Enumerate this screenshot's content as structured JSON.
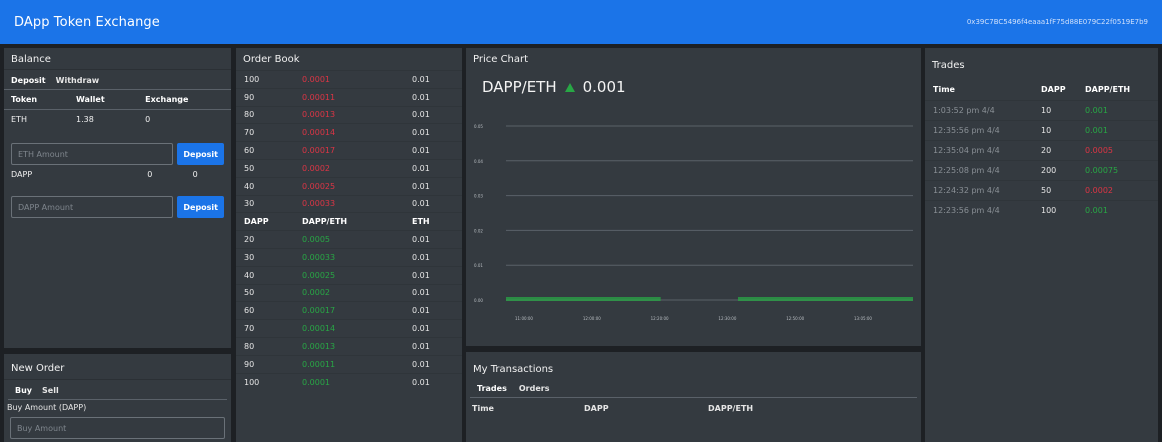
{
  "navbar": {
    "brand": "DApp Token Exchange",
    "account": "0x39C7BC5496f4eaaa1fF75d88E079C22f0519E7b9"
  },
  "balance": {
    "title": "Balance",
    "tabs": [
      "Deposit",
      "Withdraw"
    ],
    "columns": [
      "Token",
      "Wallet",
      "Exchange"
    ],
    "eth_row": [
      "ETH",
      "1.38",
      "0"
    ],
    "eth_placeholder": "ETH Amount",
    "deposit_label": "Deposit",
    "dapp_row": [
      "DAPP",
      "0",
      "0"
    ],
    "dapp_placeholder": "DAPP Amount"
  },
  "order_book": {
    "title": "Order Book",
    "sell_orders": [
      [
        "100",
        "0.0001",
        "0.01"
      ],
      [
        "90",
        "0.00011",
        "0.01"
      ],
      [
        "80",
        "0.00013",
        "0.01"
      ],
      [
        "70",
        "0.00014",
        "0.01"
      ],
      [
        "60",
        "0.00017",
        "0.01"
      ],
      [
        "50",
        "0.0002",
        "0.01"
      ],
      [
        "40",
        "0.00025",
        "0.01"
      ],
      [
        "30",
        "0.00033",
        "0.01"
      ]
    ],
    "header": [
      "DAPP",
      "DAPP/ETH",
      "ETH"
    ],
    "buy_orders": [
      [
        "20",
        "0.0005",
        "0.01"
      ],
      [
        "30",
        "0.00033",
        "0.01"
      ],
      [
        "40",
        "0.00025",
        "0.01"
      ],
      [
        "50",
        "0.0002",
        "0.01"
      ],
      [
        "60",
        "0.00017",
        "0.01"
      ],
      [
        "70",
        "0.00014",
        "0.01"
      ],
      [
        "80",
        "0.00013",
        "0.01"
      ],
      [
        "90",
        "0.00011",
        "0.01"
      ],
      [
        "100",
        "0.0001",
        "0.01"
      ]
    ]
  },
  "price_chart": {
    "title": "Price Chart",
    "pair": "DAPP/ETH",
    "price": "0.001",
    "colors": {
      "up": "#28a745",
      "grid": "#5a6169"
    }
  },
  "chart_data": {
    "type": "line",
    "y_ticks": [
      "0.05",
      "0.04",
      "0.03",
      "0.02",
      "0.01",
      "0.00"
    ],
    "x_ticks": [
      "11:00:00",
      "12:00:00",
      "12:20:00",
      "12:30:00",
      "12:50:00",
      "13:05:00"
    ],
    "ylim": [
      0,
      0.05
    ],
    "series": [
      {
        "segments": [
          [
            0.0,
            0.0
          ],
          [
            0.38,
            0.0
          ]
        ]
      },
      {
        "segments": [
          [
            0.57,
            0.0
          ],
          [
            1.0,
            0.0
          ]
        ]
      }
    ],
    "grid": true
  },
  "transactions": {
    "title": "My Transactions",
    "tabs": [
      "Trades",
      "Orders"
    ],
    "columns": [
      "Time",
      "DAPP",
      "DAPP/ETH"
    ]
  },
  "trades": {
    "title": "Trades",
    "columns": [
      "Time",
      "DAPP",
      "DAPP/ETH"
    ],
    "rows": [
      {
        "time": "1:03:52 pm 4/4",
        "dapp": "10",
        "price": "0.001",
        "dir": "green"
      },
      {
        "time": "12:35:56 pm 4/4",
        "dapp": "10",
        "price": "0.001",
        "dir": "green"
      },
      {
        "time": "12:35:04 pm 4/4",
        "dapp": "20",
        "price": "0.0005",
        "dir": "red"
      },
      {
        "time": "12:25:08 pm 4/4",
        "dapp": "200",
        "price": "0.00075",
        "dir": "green"
      },
      {
        "time": "12:24:32 pm 4/4",
        "dapp": "50",
        "price": "0.0002",
        "dir": "red"
      },
      {
        "time": "12:23:56 pm 4/4",
        "dapp": "100",
        "price": "0.001",
        "dir": "green"
      }
    ]
  },
  "new_order": {
    "title": "New Order",
    "tabs": [
      "Buy",
      "Sell"
    ],
    "amount_label": "Buy Amount (DAPP)",
    "amount_placeholder": "Buy Amount"
  }
}
